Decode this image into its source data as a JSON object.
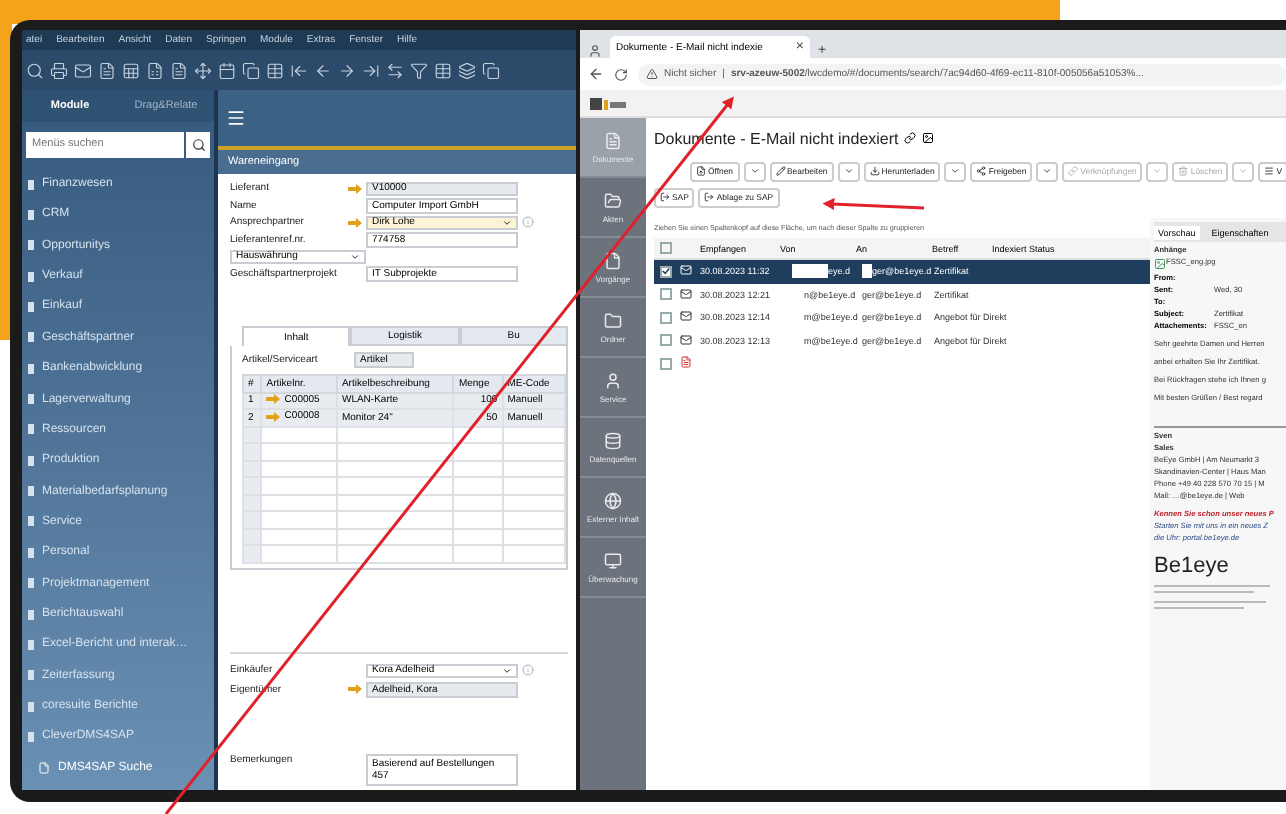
{
  "sap": {
    "menu": [
      "atei",
      "Bearbeiten",
      "Ansicht",
      "Daten",
      "Springen",
      "Module",
      "Extras",
      "Fenster",
      "Hilfe"
    ],
    "sidebar": {
      "tabs": [
        {
          "label": "Module",
          "selected": true
        },
        {
          "label": "Drag&Relate",
          "selected": false
        }
      ],
      "search": {
        "placeholder": "Menüs suchen"
      },
      "items": [
        {
          "label": "Finanzwesen",
          "selected": false
        },
        {
          "label": "CRM",
          "selected": false
        },
        {
          "label": "Opportunitys",
          "selected": false
        },
        {
          "label": "Verkauf",
          "selected": false
        },
        {
          "label": "Einkauf",
          "selected": false
        },
        {
          "label": "Geschäftspartner",
          "selected": false
        },
        {
          "label": "Bankenabwicklung",
          "selected": false
        },
        {
          "label": "Lagerverwaltung",
          "selected": false
        },
        {
          "label": "Ressourcen",
          "selected": false
        },
        {
          "label": "Produktion",
          "selected": false
        },
        {
          "label": "Materialbedarfsplanung",
          "selected": false
        },
        {
          "label": "Service",
          "selected": false
        },
        {
          "label": "Personal",
          "selected": false
        },
        {
          "label": "Projektmanagement",
          "selected": false
        },
        {
          "label": "Berichtauswahl",
          "selected": false
        },
        {
          "label": "Excel-Bericht und interak…",
          "selected": false
        },
        {
          "label": "Zeiterfassung",
          "selected": false
        },
        {
          "label": "coresuite Berichte",
          "selected": false
        },
        {
          "label": "CleverDMS4SAP",
          "selected": false
        },
        {
          "label": "DMS4SAP Suche",
          "selected": true
        }
      ]
    },
    "document": {
      "title": "Wareneingang",
      "fields": [
        {
          "kind": "field",
          "label": "Lieferant",
          "value": "V10000",
          "link": true,
          "dropdown": false,
          "highlight": false
        },
        {
          "kind": "field",
          "label": "Name",
          "value": "Computer Import GmbH",
          "link": false,
          "dropdown": false,
          "highlight": false
        },
        {
          "kind": "field",
          "label": "Ansprechpartner",
          "value": "Dirk Lohe",
          "link": true,
          "dropdown": true,
          "highlight": true
        },
        {
          "kind": "field",
          "label": "Lieferantenref.nr.",
          "value": "774758",
          "link": false,
          "dropdown": false,
          "highlight": false
        },
        {
          "kind": "select",
          "label": "Hauswährung"
        },
        {
          "kind": "field",
          "label": "Geschäftspartnerprojekt",
          "value": "IT Subprojekte",
          "link": false,
          "dropdown": false,
          "highlight": false
        }
      ],
      "tabs": [
        {
          "label": "Inhalt",
          "selected": true
        },
        {
          "label": "Logistik",
          "selected": false
        },
        {
          "label": "Bu",
          "selected": false
        }
      ],
      "item_type": {
        "label": "Artikel/Serviceart",
        "value": "Artikel"
      },
      "table": {
        "columns": [
          "#",
          "Artikelnr.",
          "Artikelbeschreibung",
          "Menge",
          "ME-Code"
        ],
        "rows": [
          [
            "1",
            "C00005",
            "WLAN-Karte",
            "100",
            "Manuell"
          ],
          [
            "2",
            "C00008",
            "Monitor 24\"",
            "50",
            "Manuell"
          ]
        ]
      },
      "lower_fields": [
        {
          "kind": "field",
          "label": "Einkäufer",
          "value": "Kora Adelheid",
          "link": false,
          "dropdown": true,
          "highlight": false
        },
        {
          "kind": "field",
          "label": "Eigentümer",
          "value": "Adelheid, Kora",
          "link": true,
          "dropdown": false,
          "highlight": false
        }
      ],
      "remarks": {
        "label": "Bemerkungen",
        "value": "Basierend auf Bestellungen 457"
      }
    }
  },
  "browser": {
    "tab": {
      "title": "Dokumente - E-Mail nicht indexie",
      "close": "×"
    },
    "new_tab": "+",
    "address": {
      "warning": "Nicht sicher",
      "separator": "|",
      "host": "srv-azeuw-5002",
      "path": "/lwcdemo/#/documents/search/7ac94d60-4f69-ec11-810f-005056a51053%..."
    },
    "nav": [
      {
        "label": "Dokumente",
        "selected": true
      },
      {
        "label": "Akten",
        "selected": false
      },
      {
        "label": "Vorgänge",
        "selected": false
      },
      {
        "label": "Ordner",
        "selected": false
      },
      {
        "label": "Service",
        "selected": false
      },
      {
        "label": "Datenquellen",
        "selected": false
      },
      {
        "label": "Externer Inhalt",
        "selected": false
      },
      {
        "label": "Überwachung",
        "selected": false
      }
    ],
    "title": "Dokumente - E-Mail nicht indexiert",
    "toolbar": [
      {
        "label": "Öffnen",
        "disabled": false
      },
      {
        "label": "Bearbeiten",
        "disabled": false
      },
      {
        "label": "Herunterladen",
        "disabled": false
      },
      {
        "label": "Freigeben",
        "disabled": false
      },
      {
        "label": "Verknüpfungen",
        "disabled": true
      },
      {
        "label": "Löschen",
        "disabled": true
      },
      {
        "label": "V",
        "disabled": false
      }
    ],
    "sap_buttons": [
      "SAP",
      "Ablage zu SAP"
    ],
    "group_hint": "Ziehen Sie einen Spaltenkopf auf diese Fläche, um nach dieser Spalte zu gruppieren",
    "select_all": {
      "checked": false
    },
    "columns": [
      "Empfangen",
      "Von",
      "An",
      "Betreff",
      "Indexiert Status"
    ],
    "rows": [
      {
        "kind": "email",
        "checked": true,
        "selected": true,
        "received": "30.08.2023 11:32",
        "from": "eye.d",
        "to": "ger@be1eye.d",
        "subject": "Zertifikat"
      },
      {
        "kind": "email",
        "checked": false,
        "selected": false,
        "received": "30.08.2023 12:21",
        "from": "n@be1eye.d",
        "to": "ger@be1eye.d",
        "subject": "Zertifikat"
      },
      {
        "kind": "email",
        "checked": false,
        "selected": false,
        "received": "30.08.2023 12:14",
        "from": "m@be1eye.d",
        "to": "ger@be1eye.d",
        "subject": "Angebot für Direkt"
      },
      {
        "kind": "email",
        "checked": false,
        "selected": false,
        "received": "30.08.2023 12:13",
        "from": "m@be1eye.d",
        "to": "ger@be1eye.d",
        "subject": "Angebot für Direkt"
      },
      {
        "kind": "pdf",
        "checked": false,
        "selected": false
      }
    ],
    "preview": {
      "tabs": [
        {
          "label": "Vorschau",
          "selected": true
        },
        {
          "label": "Eigenschaften",
          "selected": false
        }
      ],
      "attachments_label": "Anhänge",
      "attachment": "FSSC_eng.jpg",
      "headers": [
        {
          "label": "From:"
        },
        {
          "label": "Sent:",
          "value": "Wed, 30"
        },
        {
          "label": "To:"
        },
        {
          "label": "Subject:",
          "value": "Zertifikat"
        },
        {
          "label": "Attachements:",
          "value": "FSSC_en"
        }
      ],
      "body": [
        "Sehr geehrte Damen und Herren",
        "anbei erhalten Sie Ihr Zertifikat.",
        "Bei Rückfragen stehe ich Ihnen g",
        "Mit besten Grüßen / Best regard"
      ],
      "signature": [
        "Sven",
        "Sales",
        "BeEye GmbH | Am Neumarkt 3",
        "Skandinavien-Center | Haus Man",
        "Phone +49 40 228 570 70 15 | M",
        "Mail: …@be1eye.de | Web"
      ],
      "promo_title": "Kennen Sie schon unser neues P",
      "promo": [
        "Starten Sie mit uns in ein neues Z",
        "die Uhr: portal.be1eye.de"
      ],
      "logo": "Be1eye"
    }
  }
}
